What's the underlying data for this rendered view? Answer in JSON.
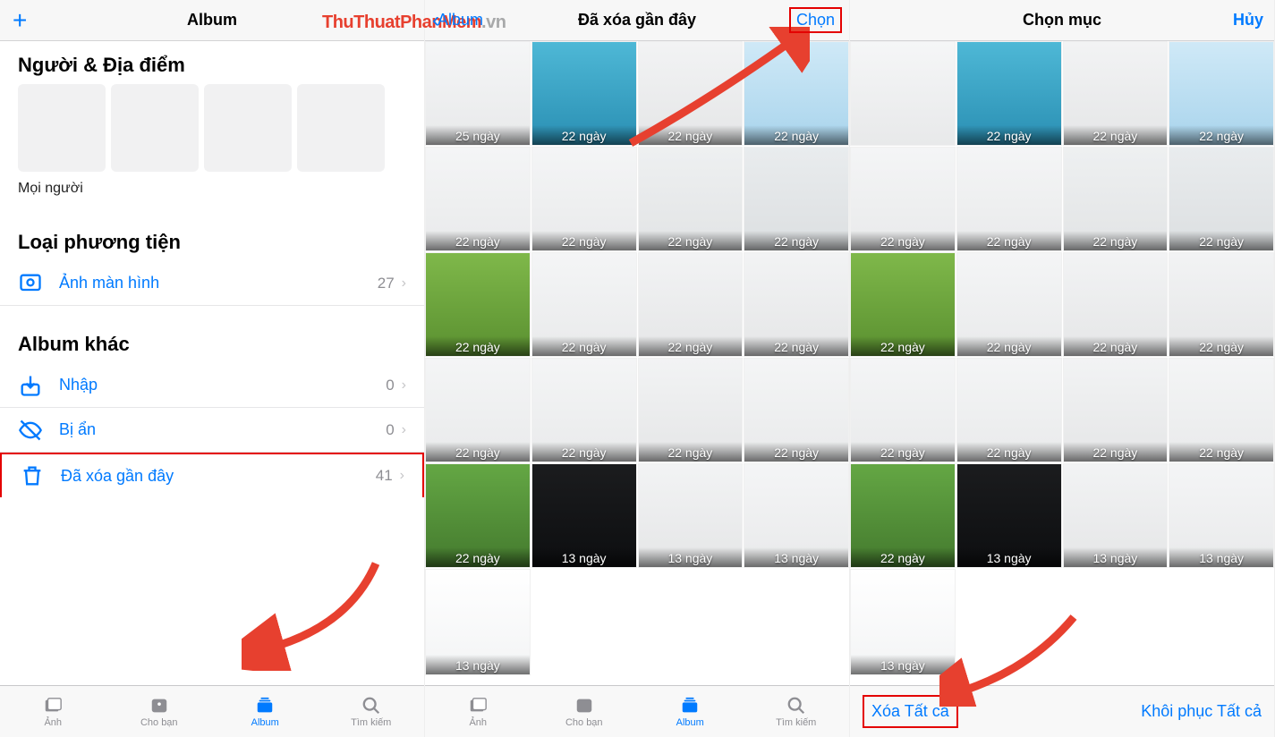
{
  "watermark": {
    "part1": "ThuThuatPhanMem",
    "part2": ".vn"
  },
  "col1": {
    "header_title": "Album",
    "sections": {
      "people_places": "Người & Địa điểm",
      "people_label": "Mọi người",
      "media_types": "Loại phương tiện",
      "other_albums": "Album khác"
    },
    "media_rows": [
      {
        "label": "Ảnh màn hình",
        "count": "27"
      }
    ],
    "other_rows": [
      {
        "label": "Nhập",
        "count": "0"
      },
      {
        "label": "Bị ẩn",
        "count": "0"
      },
      {
        "label": "Đã xóa gần đây",
        "count": "41"
      }
    ],
    "tabs": [
      {
        "label": "Ảnh"
      },
      {
        "label": "Cho bạn"
      },
      {
        "label": "Album"
      },
      {
        "label": "Tìm kiếm"
      }
    ]
  },
  "col2": {
    "back_label": "Album",
    "header_title": "Đã xóa gần đây",
    "action_label": "Chọn",
    "days": [
      "25 ngày",
      "22 ngày",
      "22 ngày",
      "22 ngày",
      "22 ngày",
      "22 ngày",
      "22 ngày",
      "22 ngày",
      "22 ngày",
      "22 ngày",
      "22 ngày",
      "22 ngày",
      "22 ngày",
      "22 ngày",
      "22 ngày",
      "22 ngày",
      "22 ngày",
      "13 ngày",
      "13 ngày",
      "13 ngày",
      "13 ngày"
    ],
    "tabs": [
      {
        "label": "Ảnh"
      },
      {
        "label": "Cho bạn"
      },
      {
        "label": "Album"
      },
      {
        "label": "Tìm kiếm"
      }
    ]
  },
  "col3": {
    "header_title": "Chọn mục",
    "cancel_label": "Hủy",
    "days": [
      "",
      "22 ngày",
      "22 ngày",
      "22 ngày",
      "22 ngày",
      "22 ngày",
      "22 ngày",
      "22 ngày",
      "22 ngày",
      "22 ngày",
      "22 ngày",
      "22 ngày",
      "22 ngày",
      "22 ngày",
      "22 ngày",
      "22 ngày",
      "22 ngày",
      "13 ngày",
      "13 ngày",
      "13 ngày",
      "13 ngày"
    ],
    "footer": {
      "delete_all": "Xóa Tất cả",
      "restore_all": "Khôi phục Tất cả"
    }
  }
}
